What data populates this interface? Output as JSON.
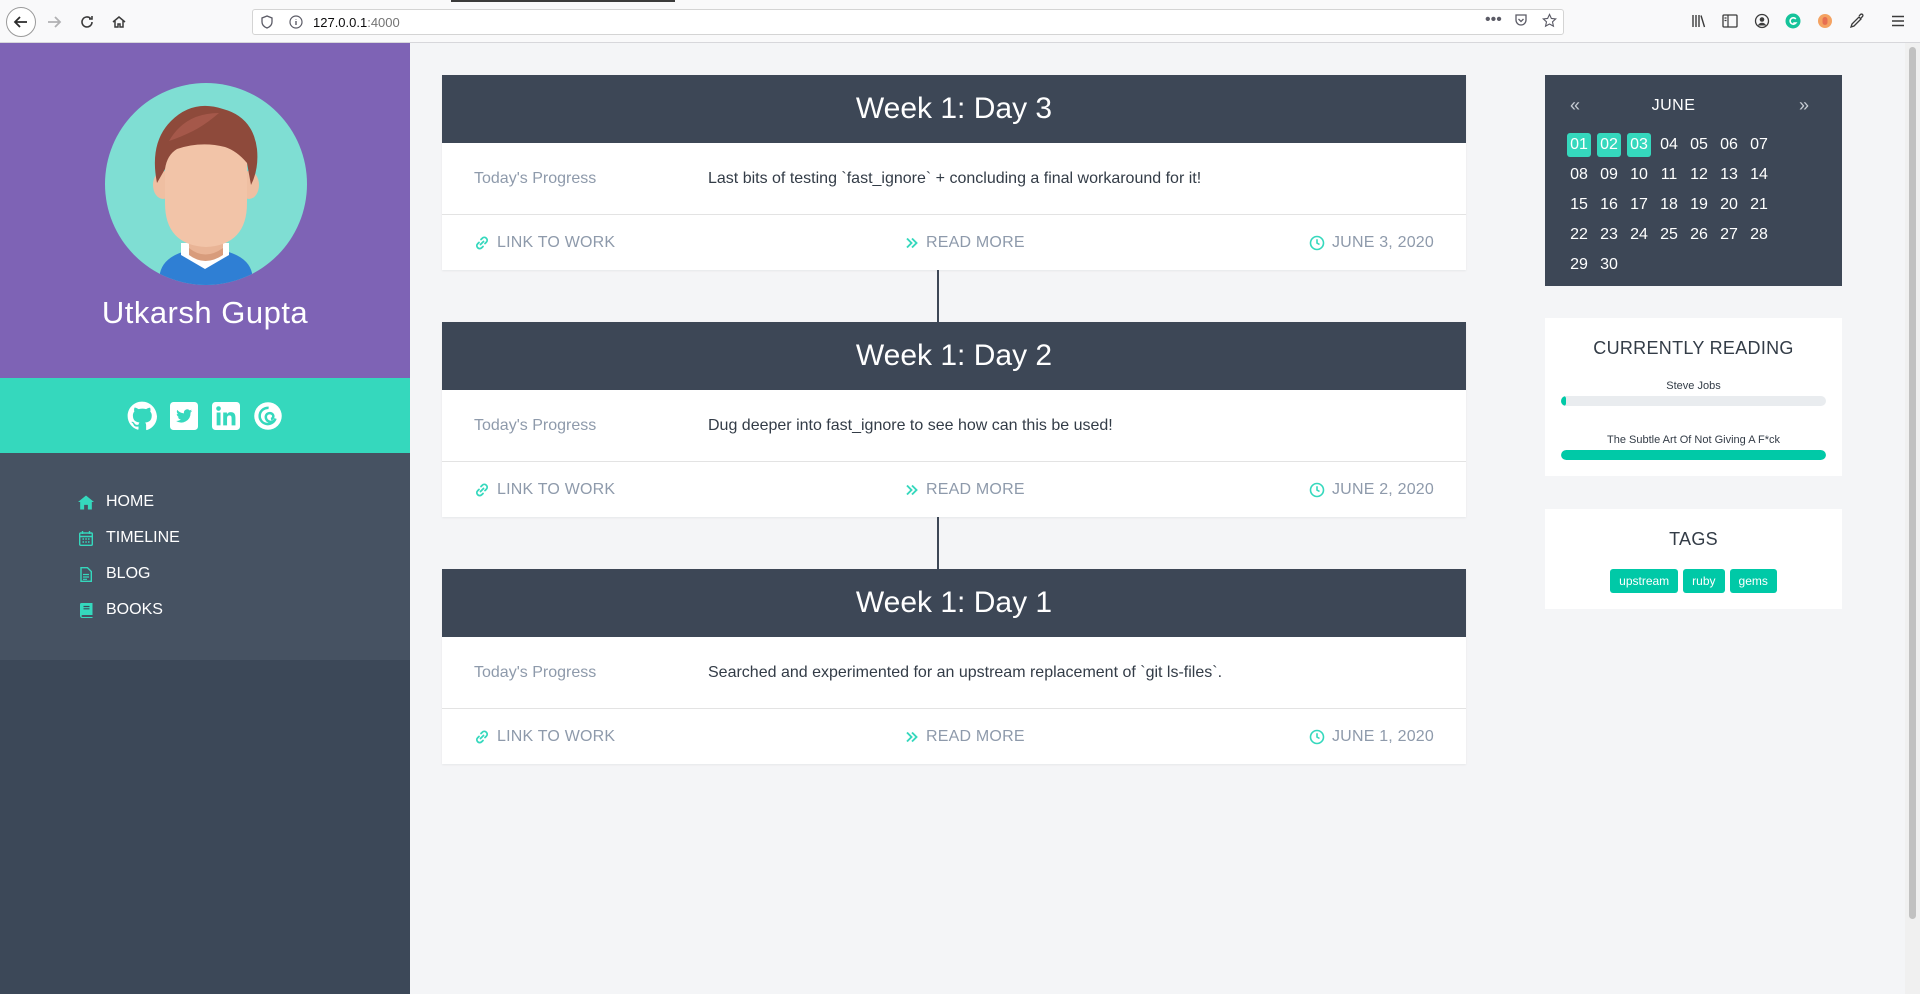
{
  "browser": {
    "url_host": "127.0.0.1",
    "url_port": ":4000"
  },
  "profile": {
    "name": "Utkarsh Gupta"
  },
  "social": [
    "github-icon",
    "twitter-icon",
    "linkedin-icon",
    "debian-icon"
  ],
  "menu": [
    {
      "label": "HOME",
      "icon": "home-icon"
    },
    {
      "label": "TIMELINE",
      "icon": "calendar-icon"
    },
    {
      "label": "BLOG",
      "icon": "file-icon"
    },
    {
      "label": "BOOKS",
      "icon": "book-icon"
    }
  ],
  "posts": [
    {
      "title": "Week 1: Day 3",
      "label": "Today's Progress",
      "text": "Last bits of testing `fast_ignore` + concluding a final workaround for it!",
      "link": "LINK TO WORK",
      "read": "READ MORE",
      "date": "JUNE 3, 2020"
    },
    {
      "title": "Week 1: Day 2",
      "label": "Today's Progress",
      "text": "Dug deeper into fast_ignore to see how can this be used!",
      "link": "LINK TO WORK",
      "read": "READ MORE",
      "date": "JUNE 2, 2020"
    },
    {
      "title": "Week 1: Day 1",
      "label": "Today's Progress",
      "text": "Searched and experimented for an upstream replacement of `git ls-files`.",
      "link": "LINK TO WORK",
      "read": "READ MORE",
      "date": "JUNE 1, 2020"
    }
  ],
  "calendar": {
    "month": "JUNE",
    "prev": "«",
    "next": "»",
    "days": [
      "01",
      "02",
      "03",
      "04",
      "05",
      "06",
      "07",
      "08",
      "09",
      "10",
      "11",
      "12",
      "13",
      "14",
      "15",
      "16",
      "17",
      "18",
      "19",
      "20",
      "21",
      "22",
      "23",
      "24",
      "25",
      "26",
      "27",
      "28",
      "29",
      "30"
    ],
    "active_days": [
      "01",
      "02",
      "03"
    ]
  },
  "reading": {
    "title": "CURRENTLY READING",
    "books": [
      {
        "title": "Steve Jobs",
        "progress": 0.02
      },
      {
        "title": "The Subtle Art Of Not Giving A F*ck",
        "progress": 1.0
      }
    ]
  },
  "tags": {
    "title": "TAGS",
    "items": [
      "upstream",
      "ruby",
      "gems"
    ]
  },
  "colors": {
    "accent": "#35d8bd",
    "profile_bg": "#7e63b5",
    "dark": "#3d4756",
    "muted": "#8e9aab"
  }
}
